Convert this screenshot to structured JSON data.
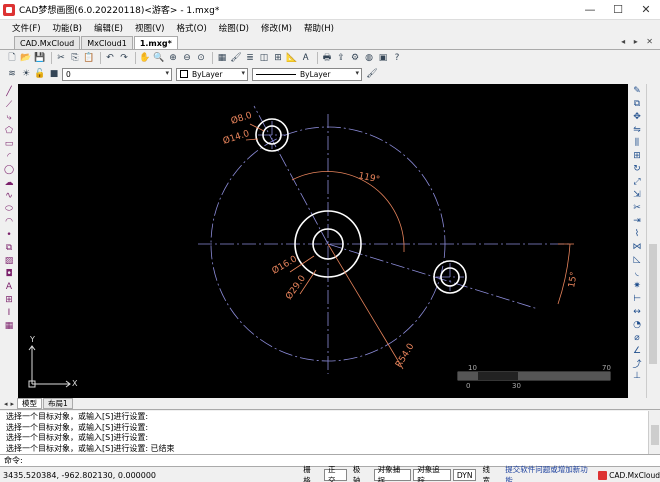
{
  "window": {
    "title": "CAD梦想画图(6.0.20220118)<游客> - 1.mxg*",
    "minimize": "—",
    "maximize": "☐",
    "close": "✕"
  },
  "menu": [
    "文件(F)",
    "功能(B)",
    "编辑(E)",
    "视图(V)",
    "格式(O)",
    "绘图(D)",
    "修改(M)",
    "帮助(H)"
  ],
  "doc_tabs": [
    {
      "label": "CAD.MxCloud",
      "active": false
    },
    {
      "label": "MxCloud1",
      "active": false
    },
    {
      "label": "1.mxg*",
      "active": true
    }
  ],
  "doc_tab_nav": "◂ ▸ ✕",
  "toolbar2": {
    "layer_value": "0",
    "color_value": "ByLayer",
    "linetype_value": "ByLayer"
  },
  "drawing": {
    "dims": {
      "d8": "Ø8.0",
      "d14": "Ø14.0",
      "angle119": "119°",
      "d16": "Ø16.0",
      "d29": "Ø29.0",
      "r54": "R54.0",
      "angle15": "15°"
    },
    "scale_labels": [
      "0",
      "10",
      "30",
      "70"
    ],
    "ucs": {
      "x": "X",
      "y": "Y"
    }
  },
  "layout_tabs": [
    {
      "label": "模型",
      "active": true
    },
    {
      "label": "布局1",
      "active": false
    }
  ],
  "command_history": [
    "选择一个目标对象，或输入[S]进行设置:",
    "选择一个目标对象，或输入[S]进行设置:",
    "选择一个目标对象，或输入[S]进行设置:",
    "选择一个目标对象，或输入[S]进行设置:  已结束"
  ],
  "command_prompt": "命令:",
  "status": {
    "coords": "3435.520384,  -962.802130,  0.000000",
    "buttons": [
      {
        "label": "栅格",
        "on": false
      },
      {
        "label": "正交",
        "on": true
      },
      {
        "label": "极轴",
        "on": false
      },
      {
        "label": "对象捕捉",
        "on": true
      },
      {
        "label": "对象追踪",
        "on": true
      },
      {
        "label": "DYN",
        "on": true
      },
      {
        "label": "线宽",
        "on": false
      }
    ],
    "feedback_link": "提交软件问题或增加新功能",
    "brand": "CAD.MxCloud"
  },
  "colors": {
    "dim": "#e8845c",
    "centerline": "#8b8bd8",
    "geometry": "#ffffff",
    "canvas": "#000000"
  }
}
